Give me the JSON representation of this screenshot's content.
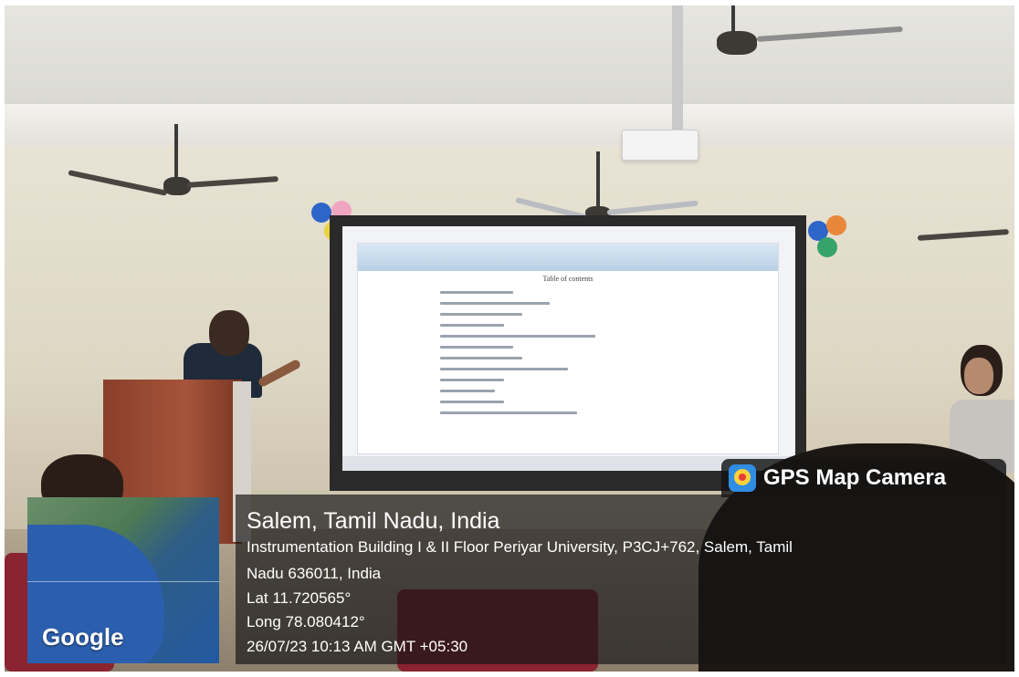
{
  "badge": {
    "label": "GPS Map Camera",
    "icon": "gps-map-camera-app-icon",
    "color": "#2f8de4"
  },
  "map": {
    "provider_label": "Google"
  },
  "location": {
    "title": "Salem, Tamil Nadu, India",
    "address_line1": "Instrumentation Building I & II Floor Periyar University, P3CJ+762, Salem, Tamil",
    "address_line2": "Nadu 636011, India",
    "lat": "Lat 11.720565°",
    "long": "Long 78.080412°",
    "timestamp": "26/07/23 10:13 AM GMT +05:30"
  },
  "slide": {
    "title": "Table of contents"
  }
}
